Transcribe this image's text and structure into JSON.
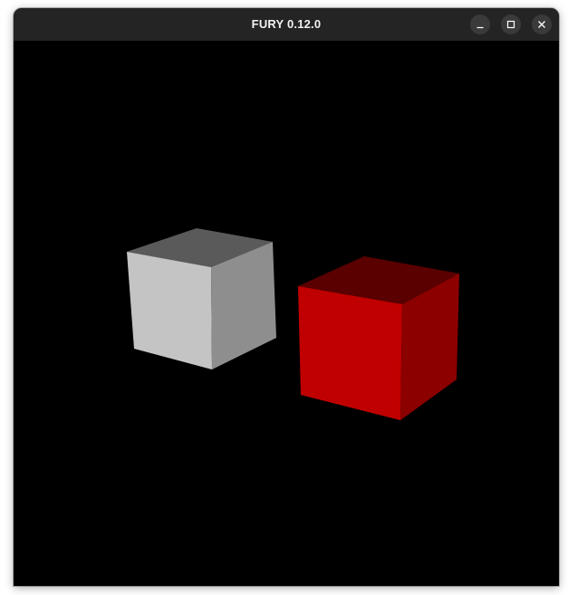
{
  "window": {
    "title": "FURY 0.12.0"
  },
  "controls": {
    "minimize_icon": "minimize-icon",
    "maximize_icon": "maximize-icon",
    "close_icon": "close-icon"
  },
  "scene": {
    "background_color": "#000000",
    "cubes": [
      {
        "name": "white-cube",
        "colors": {
          "top": "#5a5a5a",
          "front": "#c4c4c4",
          "side": "#8e8e8e"
        }
      },
      {
        "name": "red-cube",
        "colors": {
          "top": "#5a0000",
          "front": "#c00000",
          "side": "#8c0000"
        }
      }
    ]
  }
}
